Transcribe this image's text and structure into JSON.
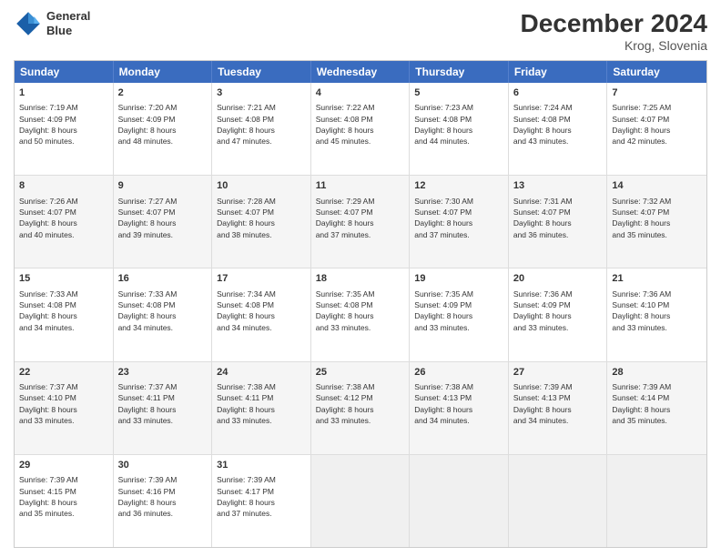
{
  "header": {
    "logo_line1": "General",
    "logo_line2": "Blue",
    "main_title": "December 2024",
    "subtitle": "Krog, Slovenia"
  },
  "days_of_week": [
    "Sunday",
    "Monday",
    "Tuesday",
    "Wednesday",
    "Thursday",
    "Friday",
    "Saturday"
  ],
  "weeks": [
    [
      {
        "day": "1",
        "lines": [
          "Sunrise: 7:19 AM",
          "Sunset: 4:09 PM",
          "Daylight: 8 hours",
          "and 50 minutes."
        ]
      },
      {
        "day": "2",
        "lines": [
          "Sunrise: 7:20 AM",
          "Sunset: 4:09 PM",
          "Daylight: 8 hours",
          "and 48 minutes."
        ]
      },
      {
        "day": "3",
        "lines": [
          "Sunrise: 7:21 AM",
          "Sunset: 4:08 PM",
          "Daylight: 8 hours",
          "and 47 minutes."
        ]
      },
      {
        "day": "4",
        "lines": [
          "Sunrise: 7:22 AM",
          "Sunset: 4:08 PM",
          "Daylight: 8 hours",
          "and 45 minutes."
        ]
      },
      {
        "day": "5",
        "lines": [
          "Sunrise: 7:23 AM",
          "Sunset: 4:08 PM",
          "Daylight: 8 hours",
          "and 44 minutes."
        ]
      },
      {
        "day": "6",
        "lines": [
          "Sunrise: 7:24 AM",
          "Sunset: 4:08 PM",
          "Daylight: 8 hours",
          "and 43 minutes."
        ]
      },
      {
        "day": "7",
        "lines": [
          "Sunrise: 7:25 AM",
          "Sunset: 4:07 PM",
          "Daylight: 8 hours",
          "and 42 minutes."
        ]
      }
    ],
    [
      {
        "day": "8",
        "lines": [
          "Sunrise: 7:26 AM",
          "Sunset: 4:07 PM",
          "Daylight: 8 hours",
          "and 40 minutes."
        ]
      },
      {
        "day": "9",
        "lines": [
          "Sunrise: 7:27 AM",
          "Sunset: 4:07 PM",
          "Daylight: 8 hours",
          "and 39 minutes."
        ]
      },
      {
        "day": "10",
        "lines": [
          "Sunrise: 7:28 AM",
          "Sunset: 4:07 PM",
          "Daylight: 8 hours",
          "and 38 minutes."
        ]
      },
      {
        "day": "11",
        "lines": [
          "Sunrise: 7:29 AM",
          "Sunset: 4:07 PM",
          "Daylight: 8 hours",
          "and 37 minutes."
        ]
      },
      {
        "day": "12",
        "lines": [
          "Sunrise: 7:30 AM",
          "Sunset: 4:07 PM",
          "Daylight: 8 hours",
          "and 37 minutes."
        ]
      },
      {
        "day": "13",
        "lines": [
          "Sunrise: 7:31 AM",
          "Sunset: 4:07 PM",
          "Daylight: 8 hours",
          "and 36 minutes."
        ]
      },
      {
        "day": "14",
        "lines": [
          "Sunrise: 7:32 AM",
          "Sunset: 4:07 PM",
          "Daylight: 8 hours",
          "and 35 minutes."
        ]
      }
    ],
    [
      {
        "day": "15",
        "lines": [
          "Sunrise: 7:33 AM",
          "Sunset: 4:08 PM",
          "Daylight: 8 hours",
          "and 34 minutes."
        ]
      },
      {
        "day": "16",
        "lines": [
          "Sunrise: 7:33 AM",
          "Sunset: 4:08 PM",
          "Daylight: 8 hours",
          "and 34 minutes."
        ]
      },
      {
        "day": "17",
        "lines": [
          "Sunrise: 7:34 AM",
          "Sunset: 4:08 PM",
          "Daylight: 8 hours",
          "and 34 minutes."
        ]
      },
      {
        "day": "18",
        "lines": [
          "Sunrise: 7:35 AM",
          "Sunset: 4:08 PM",
          "Daylight: 8 hours",
          "and 33 minutes."
        ]
      },
      {
        "day": "19",
        "lines": [
          "Sunrise: 7:35 AM",
          "Sunset: 4:09 PM",
          "Daylight: 8 hours",
          "and 33 minutes."
        ]
      },
      {
        "day": "20",
        "lines": [
          "Sunrise: 7:36 AM",
          "Sunset: 4:09 PM",
          "Daylight: 8 hours",
          "and 33 minutes."
        ]
      },
      {
        "day": "21",
        "lines": [
          "Sunrise: 7:36 AM",
          "Sunset: 4:10 PM",
          "Daylight: 8 hours",
          "and 33 minutes."
        ]
      }
    ],
    [
      {
        "day": "22",
        "lines": [
          "Sunrise: 7:37 AM",
          "Sunset: 4:10 PM",
          "Daylight: 8 hours",
          "and 33 minutes."
        ]
      },
      {
        "day": "23",
        "lines": [
          "Sunrise: 7:37 AM",
          "Sunset: 4:11 PM",
          "Daylight: 8 hours",
          "and 33 minutes."
        ]
      },
      {
        "day": "24",
        "lines": [
          "Sunrise: 7:38 AM",
          "Sunset: 4:11 PM",
          "Daylight: 8 hours",
          "and 33 minutes."
        ]
      },
      {
        "day": "25",
        "lines": [
          "Sunrise: 7:38 AM",
          "Sunset: 4:12 PM",
          "Daylight: 8 hours",
          "and 33 minutes."
        ]
      },
      {
        "day": "26",
        "lines": [
          "Sunrise: 7:38 AM",
          "Sunset: 4:13 PM",
          "Daylight: 8 hours",
          "and 34 minutes."
        ]
      },
      {
        "day": "27",
        "lines": [
          "Sunrise: 7:39 AM",
          "Sunset: 4:13 PM",
          "Daylight: 8 hours",
          "and 34 minutes."
        ]
      },
      {
        "day": "28",
        "lines": [
          "Sunrise: 7:39 AM",
          "Sunset: 4:14 PM",
          "Daylight: 8 hours",
          "and 35 minutes."
        ]
      }
    ],
    [
      {
        "day": "29",
        "lines": [
          "Sunrise: 7:39 AM",
          "Sunset: 4:15 PM",
          "Daylight: 8 hours",
          "and 35 minutes."
        ]
      },
      {
        "day": "30",
        "lines": [
          "Sunrise: 7:39 AM",
          "Sunset: 4:16 PM",
          "Daylight: 8 hours",
          "and 36 minutes."
        ]
      },
      {
        "day": "31",
        "lines": [
          "Sunrise: 7:39 AM",
          "Sunset: 4:17 PM",
          "Daylight: 8 hours",
          "and 37 minutes."
        ]
      },
      {
        "day": "",
        "lines": []
      },
      {
        "day": "",
        "lines": []
      },
      {
        "day": "",
        "lines": []
      },
      {
        "day": "",
        "lines": []
      }
    ]
  ]
}
